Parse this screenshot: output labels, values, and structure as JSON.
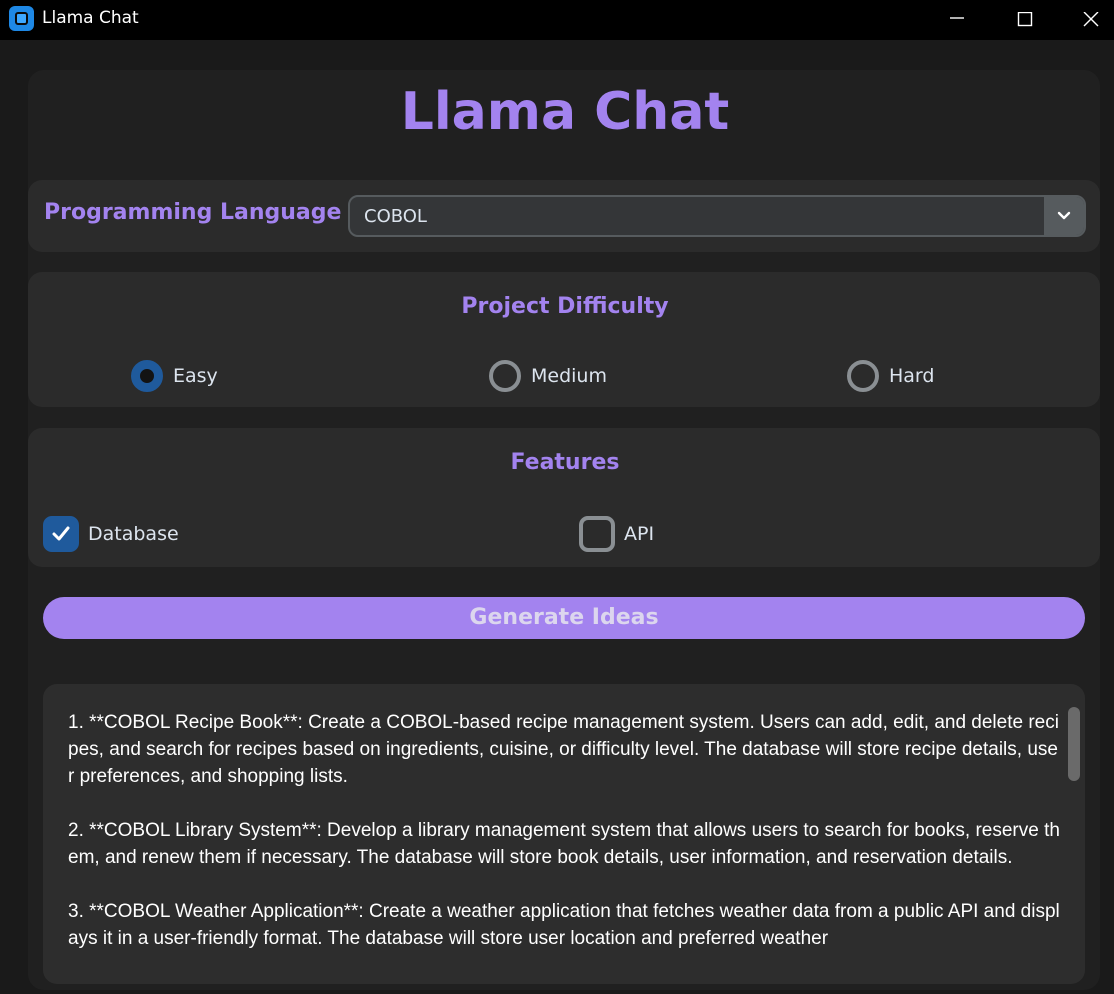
{
  "window": {
    "title": "Llama Chat",
    "icon": "app-icon",
    "controls": [
      "minimize-icon",
      "maximize-icon",
      "close-icon"
    ]
  },
  "header": {
    "title": "Llama Chat"
  },
  "language": {
    "label": "Programming Language",
    "selected": "COBOL",
    "arrow_icon": "chevron-down-icon"
  },
  "difficulty": {
    "title": "Project Difficulty",
    "options": [
      {
        "label": "Easy",
        "checked": true
      },
      {
        "label": "Medium",
        "checked": false
      },
      {
        "label": "Hard",
        "checked": false
      }
    ]
  },
  "features": {
    "title": "Features",
    "options": [
      {
        "label": "Database",
        "checked": true
      },
      {
        "label": "API",
        "checked": false
      }
    ]
  },
  "generate_button": {
    "label": "Generate Ideas"
  },
  "output": {
    "text": "1. **COBOL Recipe Book**: Create a COBOL-based recipe management system. Users can add, edit, and delete recipes, and search for recipes based on ingredients, cuisine, or difficulty level. The database will store recipe details, user preferences, and shopping lists.\n\n2. **COBOL Library System**: Develop a library management system that allows users to search for books, reserve them, and renew them if necessary. The database will store book details, user information, and reservation details.\n\n3. **COBOL Weather Application**: Create a weather application that fetches weather data from a public API and displays it in a user-friendly format. The database will store user location and preferred weather"
  },
  "colors": {
    "accent": "#a383ef",
    "selected": "#1f5a9c",
    "background": "#1a1a1a"
  }
}
